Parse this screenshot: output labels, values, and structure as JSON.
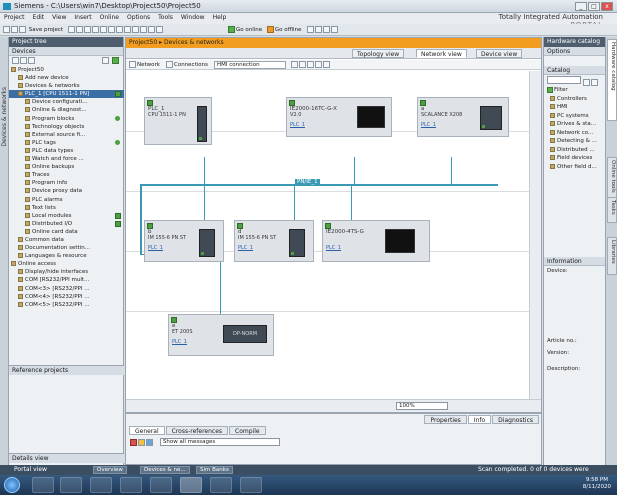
{
  "window": {
    "title": "Siemens - C:\\Users\\win7\\Desktop\\Project50\\Project50"
  },
  "brand": {
    "line1": "Totally Integrated Automation",
    "line2": "PORTAL"
  },
  "menu": [
    "Project",
    "Edit",
    "View",
    "Insert",
    "Online",
    "Options",
    "Tools",
    "Window",
    "Help"
  ],
  "toolbar": {
    "save_label": "Save project",
    "go_online": "Go online",
    "go_offline": "Go offline"
  },
  "project_tree": {
    "header": "Project tree",
    "devices_tab": "Devices",
    "side_label": "Devices & networks",
    "items": [
      {
        "label": "Project50",
        "indent": 0,
        "sel": false,
        "mark": ""
      },
      {
        "label": "Add new device",
        "indent": 1,
        "sel": false,
        "mark": ""
      },
      {
        "label": "Devices & networks",
        "indent": 1,
        "sel": false,
        "mark": ""
      },
      {
        "label": "PLC_1 [CPU 1511-1 PN]",
        "indent": 1,
        "sel": true,
        "mark": "check"
      },
      {
        "label": "Device configurati...",
        "indent": 2,
        "sel": false,
        "mark": ""
      },
      {
        "label": "Online & diagnost...",
        "indent": 2,
        "sel": false,
        "mark": ""
      },
      {
        "label": "Program blocks",
        "indent": 2,
        "sel": false,
        "mark": "dot"
      },
      {
        "label": "Technology objects",
        "indent": 2,
        "sel": false,
        "mark": ""
      },
      {
        "label": "External source fi...",
        "indent": 2,
        "sel": false,
        "mark": ""
      },
      {
        "label": "PLC tags",
        "indent": 2,
        "sel": false,
        "mark": "dot"
      },
      {
        "label": "PLC data types",
        "indent": 2,
        "sel": false,
        "mark": ""
      },
      {
        "label": "Watch and force ...",
        "indent": 2,
        "sel": false,
        "mark": ""
      },
      {
        "label": "Online backups",
        "indent": 2,
        "sel": false,
        "mark": ""
      },
      {
        "label": "Traces",
        "indent": 2,
        "sel": false,
        "mark": ""
      },
      {
        "label": "Program info",
        "indent": 2,
        "sel": false,
        "mark": ""
      },
      {
        "label": "Device proxy data",
        "indent": 2,
        "sel": false,
        "mark": ""
      },
      {
        "label": "PLC alarms",
        "indent": 2,
        "sel": false,
        "mark": ""
      },
      {
        "label": "Text lists",
        "indent": 2,
        "sel": false,
        "mark": ""
      },
      {
        "label": "Local modules",
        "indent": 2,
        "sel": false,
        "mark": "check"
      },
      {
        "label": "Distributed I/O",
        "indent": 2,
        "sel": false,
        "mark": "check"
      },
      {
        "label": "Online card data",
        "indent": 2,
        "sel": false,
        "mark": ""
      },
      {
        "label": "Common data",
        "indent": 1,
        "sel": false,
        "mark": ""
      },
      {
        "label": "Documentation settin...",
        "indent": 1,
        "sel": false,
        "mark": ""
      },
      {
        "label": "Languages & resource",
        "indent": 1,
        "sel": false,
        "mark": ""
      },
      {
        "label": "Online access",
        "indent": 0,
        "sel": false,
        "mark": ""
      },
      {
        "label": "Display/hide interfaces",
        "indent": 1,
        "sel": false,
        "mark": ""
      },
      {
        "label": "COM [RS232/PPI mult...",
        "indent": 1,
        "sel": false,
        "mark": ""
      },
      {
        "label": "COM<3> [RS232/PPI ...",
        "indent": 1,
        "sel": false,
        "mark": ""
      },
      {
        "label": "COM<4> [RS232/PPI ...",
        "indent": 1,
        "sel": false,
        "mark": ""
      },
      {
        "label": "COM<5> [RS232/PPI ...",
        "indent": 1,
        "sel": false,
        "mark": ""
      }
    ],
    "reference_projects": "Reference projects",
    "details_view": "Details view"
  },
  "editor": {
    "breadcrumb": "Project50 ▸ Devices & networks",
    "tabs": {
      "topology": "Topology view",
      "network": "Network view",
      "device": "Device view"
    },
    "tools": {
      "network": "Network",
      "connections": "Connections",
      "hmi": "HMI connection"
    },
    "zoom": "100%",
    "subnet": "PN/IE_1",
    "devices": [
      {
        "id": "plc1",
        "name": "PLC_1",
        "type": "CPU 1511-1 PN",
        "link": ""
      },
      {
        "id": "ie2000",
        "name": "IE2000-16TC-G-X",
        "type": "V2.0",
        "link": "PLC_1"
      },
      {
        "id": "hmi",
        "name": "a",
        "type": "SCALANCE X208",
        "link": "PLC_1"
      },
      {
        "id": "io1",
        "name": "b",
        "type": "IM 155-6 PN ST",
        "link": "PLC_1"
      },
      {
        "id": "io2",
        "name": "d",
        "type": "IM 155-6 PN ST",
        "link": "PLC_1"
      },
      {
        "id": "ie2000b",
        "name": "IE2000-4TS-G",
        "type": "",
        "link": "PLC_1"
      },
      {
        "id": "dp",
        "name": "e",
        "type": "ET 200S",
        "link": "PLC_1"
      }
    ],
    "dp_module_label": "DP-NORM"
  },
  "inspector": {
    "tabs_right": [
      "Properties",
      "Info",
      "Diagnostics"
    ],
    "tabs_left": [
      "General",
      "Cross-references",
      "Compile"
    ],
    "filter": "Show all messages"
  },
  "catalog": {
    "header": "Hardware catalog",
    "options": "Options",
    "section": "Catalog",
    "search_btn": "Search",
    "filter_label": "Filter",
    "items": [
      "Controllers",
      "HMI",
      "PC systems",
      "Drives & sta...",
      "Network co...",
      "Detecting & ...",
      "Distributed ...",
      "Field devices",
      "Other field d..."
    ],
    "info_section": "Information",
    "info_device": "Device:",
    "info_article": "Article no.:",
    "info_version": "Version:",
    "info_description": "Description:",
    "side_tabs": [
      "Hardware catalog",
      "Online tools",
      "Tasks",
      "Libraries"
    ]
  },
  "portalbar": {
    "portal_view": "Portal view",
    "tabs": [
      "Overview",
      "Devices & ne...",
      "Sim Banks"
    ],
    "status": "Scan completed. 0 of 0 devices were"
  },
  "taskbar": {
    "time": "9:58 PM",
    "date": "8/11/2020"
  },
  "colors": {
    "accent": "#f29d1f",
    "subnet": "#3a9ab6",
    "ok": "#4ca042",
    "panel_header": "#4e5e6e"
  }
}
